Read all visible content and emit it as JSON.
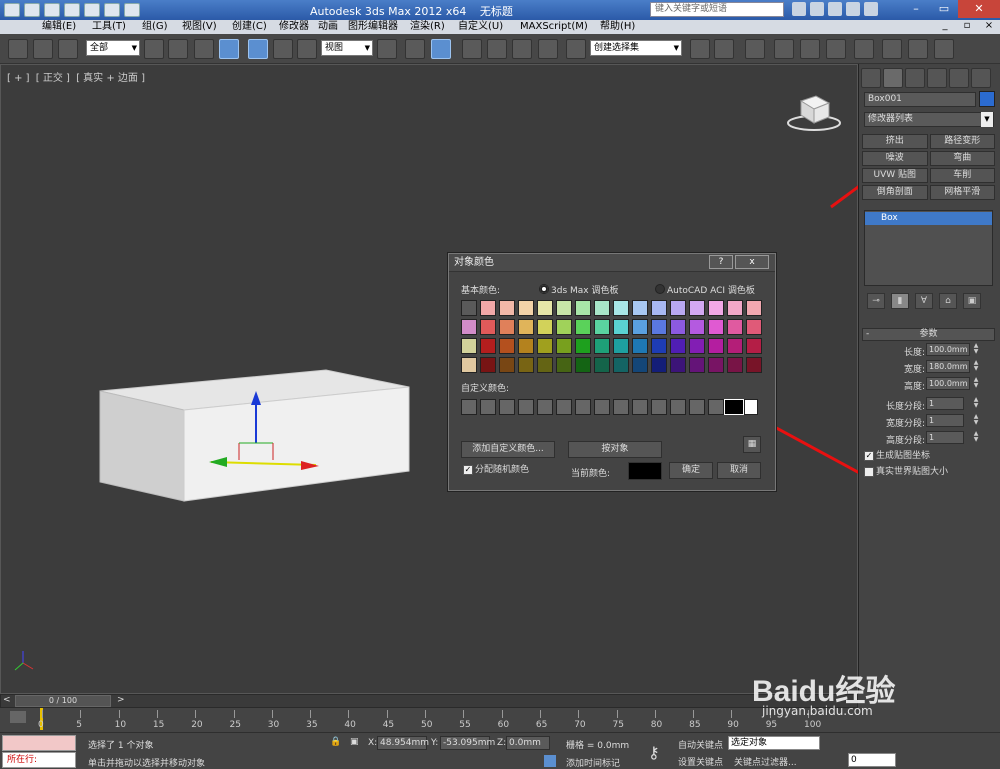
{
  "titlebar": {
    "app_title": "Autodesk 3ds Max  2012 x64",
    "doc_title": "无标题",
    "search_placeholder": "键入关键字或短语"
  },
  "menubar": {
    "items": [
      "编辑(E)",
      "工具(T)",
      "组(G)",
      "视图(V)",
      "创建(C)",
      "修改器",
      "动画",
      "图形编辑器",
      "渲染(R)",
      "自定义(U)",
      "MAXScript(M)",
      "帮助(H)"
    ]
  },
  "toolbar": {
    "selection_filter": "全部",
    "ref_coord": "视图",
    "named_selection": "创建选择集"
  },
  "viewport": {
    "label_parts": [
      "[ + ]",
      "[ 正交 ]",
      "[ 真实 + 边面 ]"
    ]
  },
  "command_panel": {
    "object_name": "Box001",
    "object_color": "#2b6bd0",
    "modifier_list": "修改器列表",
    "modifier_buttons": [
      "挤出",
      "路径变形",
      "噪波",
      "弯曲",
      "UVW 贴图",
      "车削",
      "倒角剖面",
      "网格平滑"
    ],
    "stack_item": "Box",
    "params_title": "参数",
    "params": [
      {
        "label": "长度:",
        "value": "100.0mm"
      },
      {
        "label": "宽度:",
        "value": "180.0mm"
      },
      {
        "label": "高度:",
        "value": "100.0mm"
      },
      {
        "label": "长度分段:",
        "value": "1"
      },
      {
        "label": "宽度分段:",
        "value": "1"
      },
      {
        "label": "高度分段:",
        "value": "1"
      }
    ],
    "check_gen_uv": "生成贴图坐标",
    "check_real_world": "真实世界贴图大小"
  },
  "dialog": {
    "title": "对象颜色",
    "help_btn": "?",
    "close_btn": "x",
    "basic_colors_label": "基本颜色:",
    "palette_3dsmax": "3ds Max 调色板",
    "palette_acad": "AutoCAD ACI 调色板",
    "custom_colors_label": "自定义颜色:",
    "add_custom_btn": "添加自定义颜色...",
    "by_object_btn": "按对象",
    "assign_random": "分配随机颜色",
    "current_color_label": "当前颜色:",
    "ok_btn": "确定",
    "cancel_btn": "取消",
    "swatch_colors": [
      "#5a5a5a",
      "#f2a8a8",
      "#f2b8a8",
      "#f2d2a8",
      "#e6e6a8",
      "#c8e6a8",
      "#a8e6a8",
      "#a8e6c8",
      "#a8e6e6",
      "#a8c8f2",
      "#a8b8f2",
      "#b8a8f2",
      "#d2a8f2",
      "#f2a8e6",
      "#f2a8c8",
      "#f2a8b0",
      "#d28cc8",
      "#e05a5a",
      "#e0805a",
      "#e0b45a",
      "#d2d25a",
      "#a0d25a",
      "#5ad25a",
      "#5ad2a0",
      "#5ad2d2",
      "#5aa0e0",
      "#5a78e0",
      "#8c5ae0",
      "#b45ae0",
      "#e05ad2",
      "#e05aa0",
      "#e05a78",
      "#d2d29a",
      "#b41e1e",
      "#b4501e",
      "#b4821e",
      "#a0a01e",
      "#78a01e",
      "#1ea01e",
      "#1ea078",
      "#1ea0a0",
      "#1e78b4",
      "#1e3cb4",
      "#501eb4",
      "#821eb4",
      "#b41ea0",
      "#b41e78",
      "#b41e46",
      "#e0c8a0",
      "#781414",
      "#784614",
      "#786414",
      "#646414",
      "#466414",
      "#146414",
      "#14644a",
      "#146464",
      "#144678",
      "#141e78",
      "#3c1478",
      "#641478",
      "#781464",
      "#781446",
      "#781428"
    ],
    "custom_swatches": 15
  },
  "timeline": {
    "frame_counter": "0 / 100",
    "ticks": [
      "0",
      "5",
      "10",
      "15",
      "20",
      "25",
      "30",
      "35",
      "40",
      "45",
      "50",
      "55",
      "60",
      "65",
      "70",
      "75",
      "80",
      "85",
      "90",
      "95",
      "100"
    ]
  },
  "status": {
    "script_label": "所在行:",
    "selected_msg": "选择了 1 个对象",
    "prompt_msg": "单击并拖动以选择并移动对象",
    "x_label": "X:",
    "x_value": "48.954mm",
    "y_label": "Y:",
    "y_value": "-53.095mm",
    "z_label": "Z:",
    "z_value": "0.0mm",
    "grid": "栅格 = 0.0mm",
    "add_time_tag": "添加时间标记",
    "auto_key": "自动关键点",
    "selected_obj": "选定对象",
    "set_key": "设置关键点",
    "key_filters": "关键点过滤器...",
    "frame_value": "0"
  },
  "watermark": {
    "text": "Baidu经验",
    "url": "jingyan.baidu.com"
  }
}
